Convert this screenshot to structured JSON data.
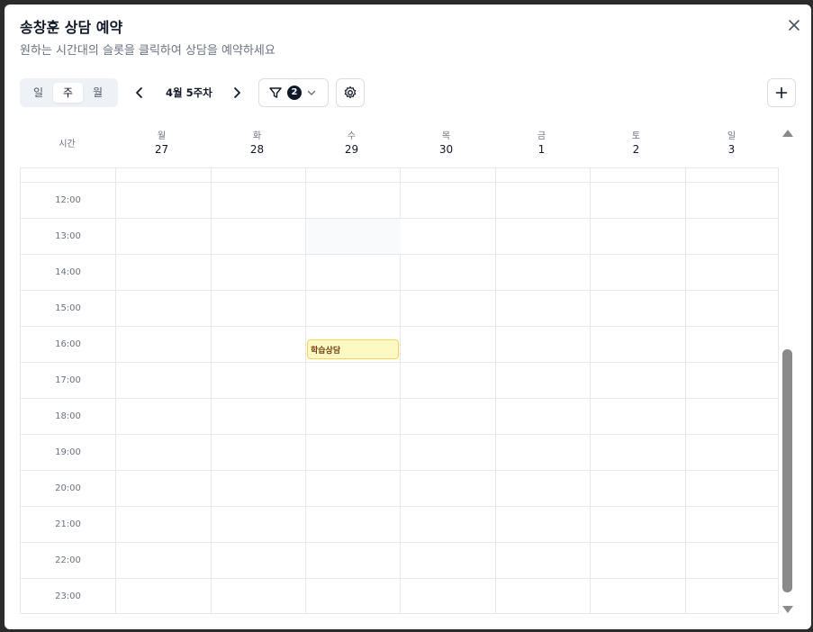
{
  "modal": {
    "title": "송창훈 상담 예약",
    "subtitle": "원하는 시간대의 슬롯을 클릭하여 상담을 예약하세요"
  },
  "toolbar": {
    "view_options": [
      "일",
      "주",
      "월"
    ],
    "active_view": "주",
    "week_label": "4월 5주차",
    "filter_count": "2",
    "icons": {
      "prev": "chevron-left-icon",
      "next": "chevron-right-icon",
      "filter": "filter-icon",
      "dropdown": "chevron-down-icon",
      "settings": "gear-icon",
      "add": "plus-icon",
      "close": "close-icon"
    }
  },
  "calendar": {
    "time_header": "시간",
    "days": [
      {
        "name": "월",
        "date": "27"
      },
      {
        "name": "화",
        "date": "28"
      },
      {
        "name": "수",
        "date": "29"
      },
      {
        "name": "목",
        "date": "30"
      },
      {
        "name": "금",
        "date": "1"
      },
      {
        "name": "토",
        "date": "2"
      },
      {
        "name": "일",
        "date": "3"
      }
    ],
    "times": [
      "12:00",
      "13:00",
      "14:00",
      "15:00",
      "16:00",
      "17:00",
      "18:00",
      "19:00",
      "20:00",
      "21:00",
      "22:00",
      "23:00"
    ],
    "events": [
      {
        "label": "학습상담",
        "day": "수",
        "time": "16:00"
      }
    ]
  },
  "colors": {
    "event_bg": "#fef9c3",
    "event_border": "#fcd34d",
    "grid_line": "#e5e7eb"
  }
}
